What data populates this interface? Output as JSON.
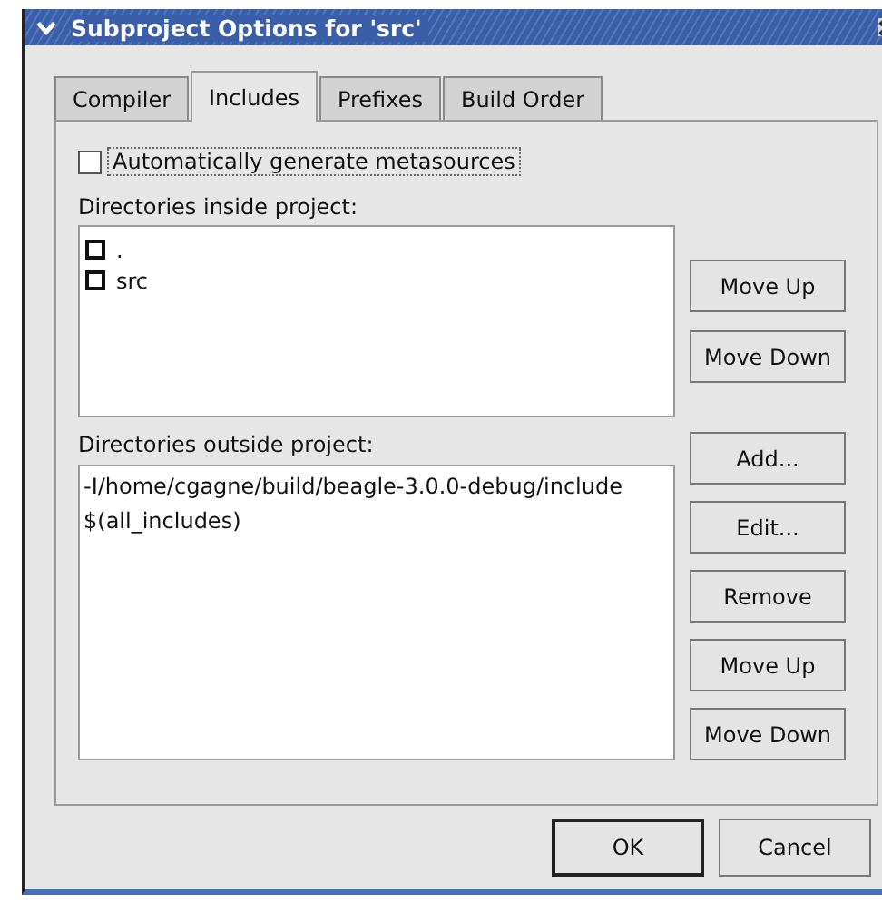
{
  "window": {
    "title": "Subproject Options for 'src'"
  },
  "tabs": [
    {
      "label": "Compiler",
      "selected": false
    },
    {
      "label": "Includes",
      "selected": true
    },
    {
      "label": "Prefixes",
      "selected": false
    },
    {
      "label": "Build Order",
      "selected": false
    }
  ],
  "auto_generate": {
    "label": "Automatically generate metasources",
    "checked": false
  },
  "inside": {
    "label": "Directories inside project:",
    "items": [
      {
        "name": ".",
        "checked": false
      },
      {
        "name": "src",
        "checked": false
      }
    ],
    "buttons": [
      "Move Up",
      "Move Down"
    ]
  },
  "outside": {
    "label": "Directories outside project:",
    "items": [
      "-I/home/cgagne/build/beagle-3.0.0-debug/include",
      "$(all_includes)"
    ],
    "buttons": [
      "Add...",
      "Edit...",
      "Remove",
      "Move Up",
      "Move Down"
    ]
  },
  "dialog_buttons": [
    {
      "label": "OK",
      "default": true
    },
    {
      "label": "Cancel",
      "default": false
    }
  ]
}
